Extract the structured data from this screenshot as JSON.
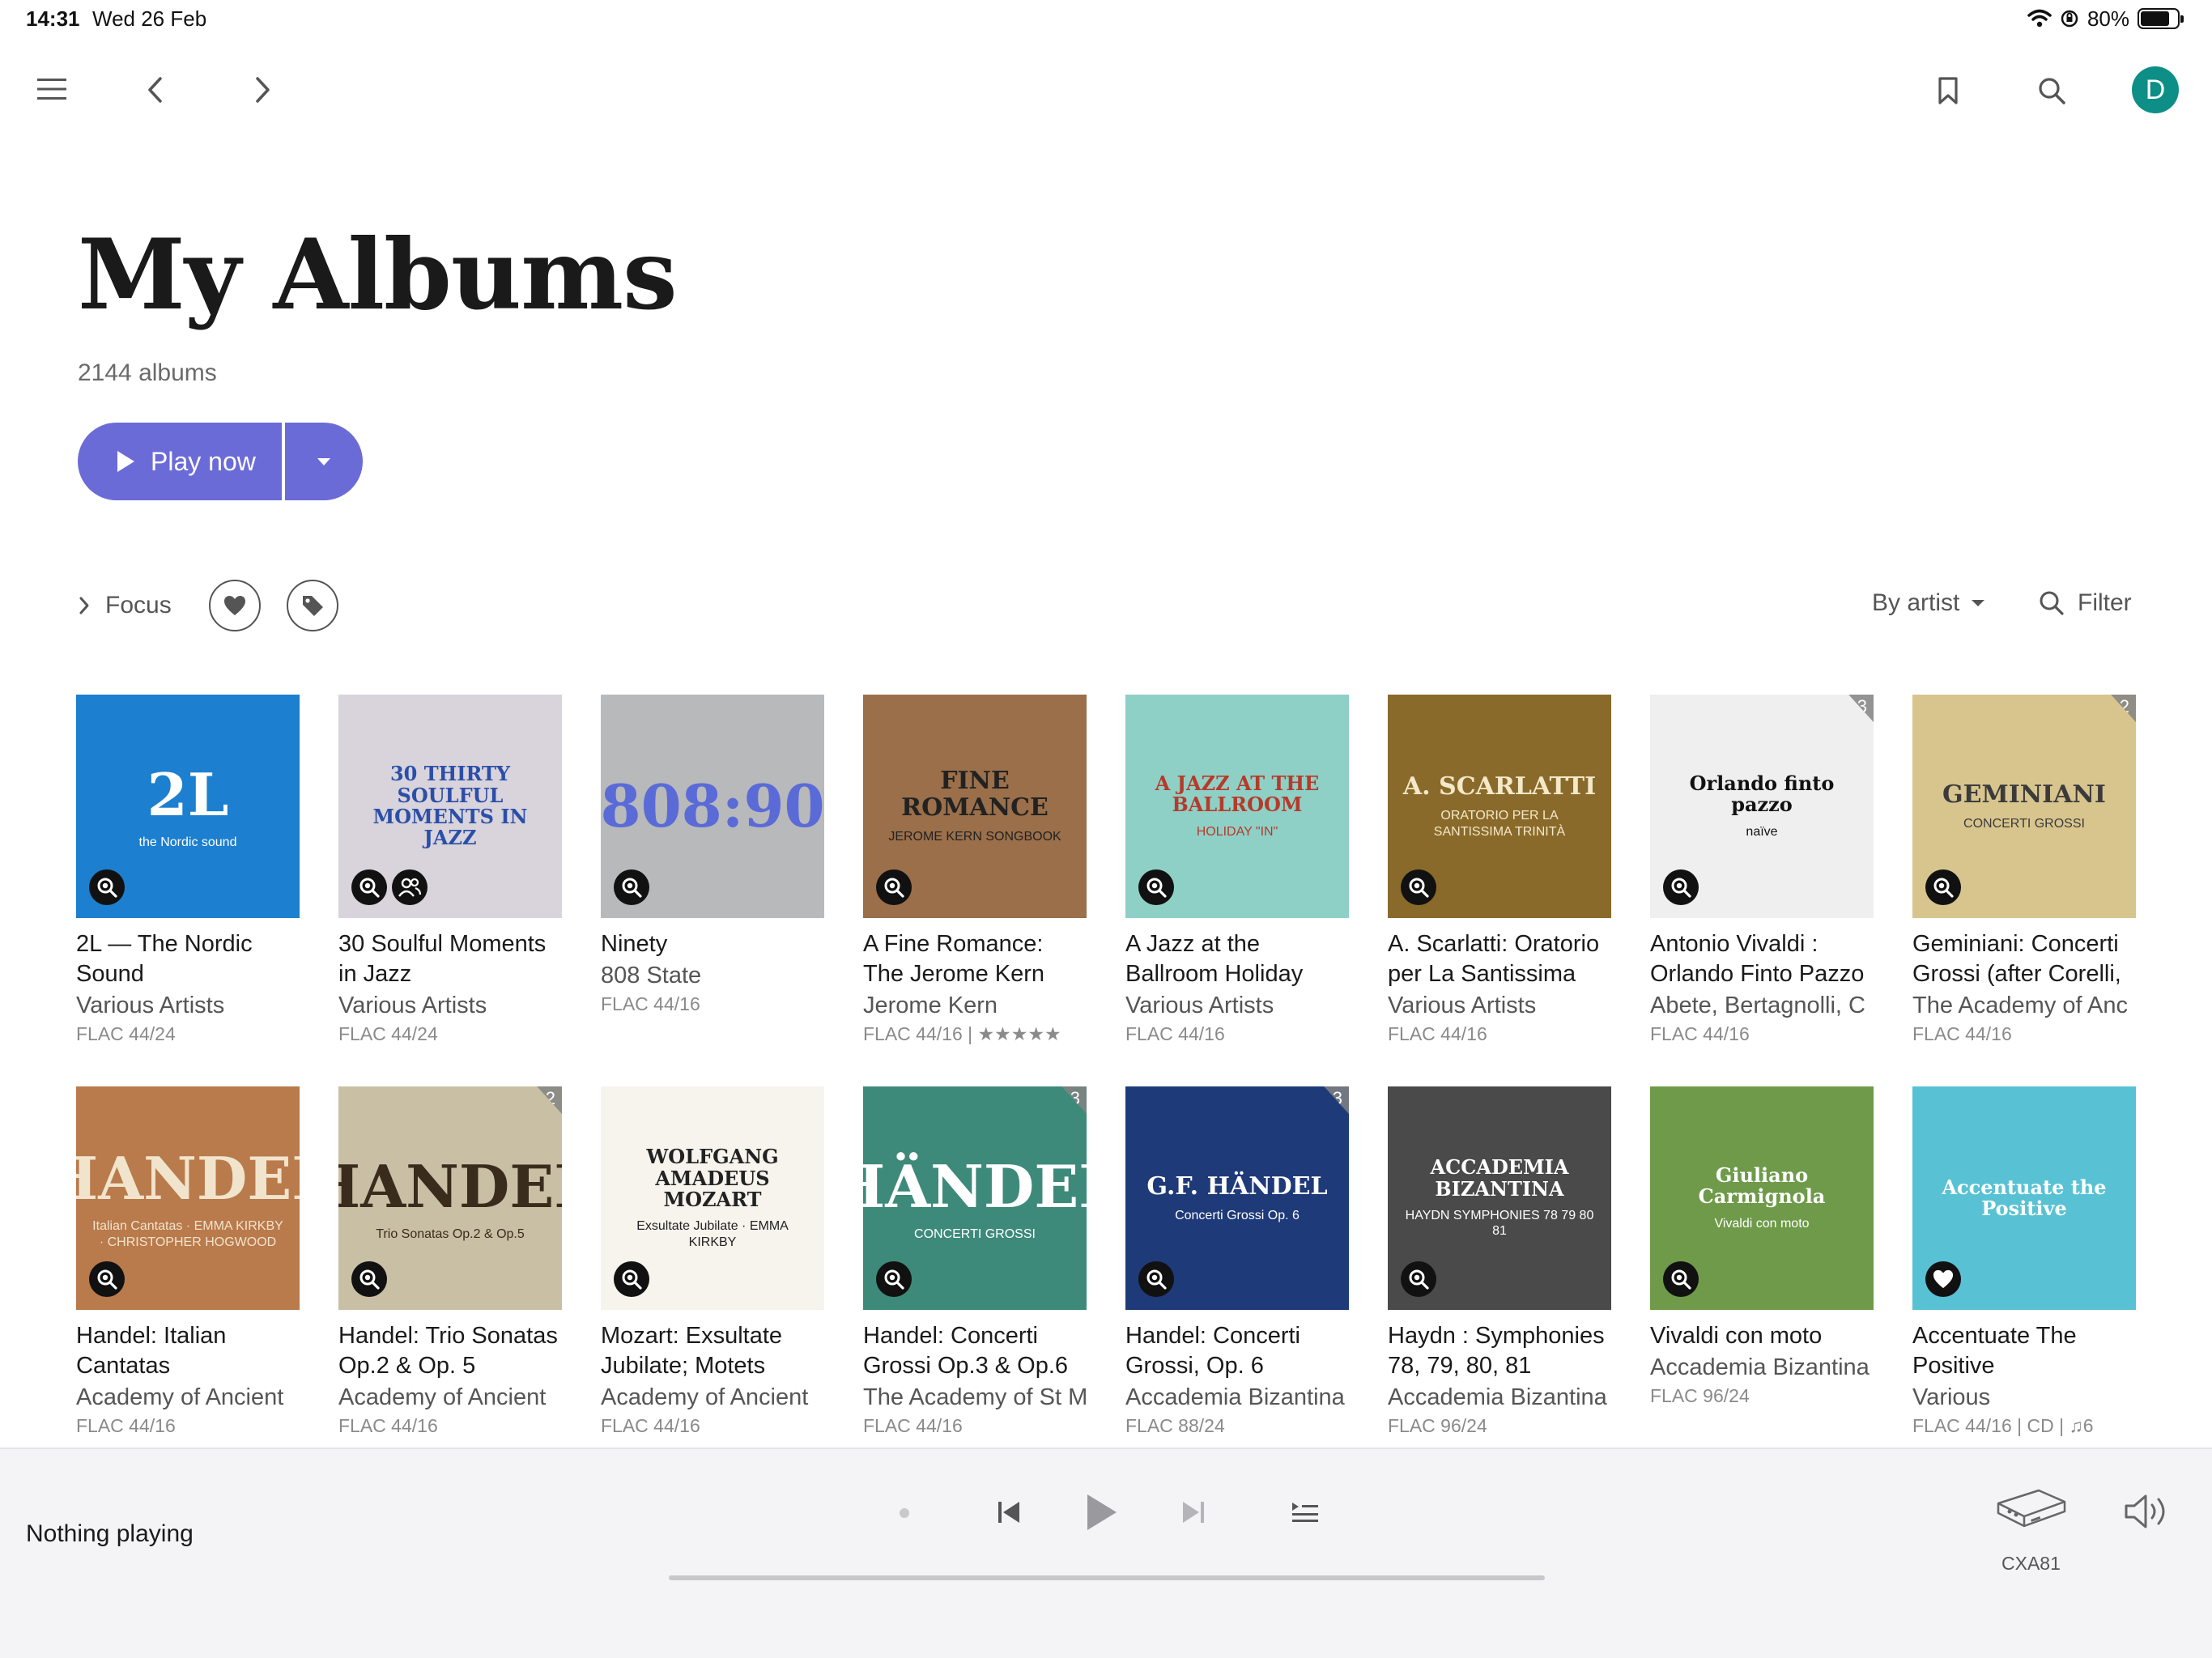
{
  "status_bar": {
    "time": "14:31",
    "date": "Wed 26 Feb",
    "battery": "80%",
    "battery_level": 0.8
  },
  "header": {
    "avatar_letter": "D"
  },
  "page": {
    "title": "My Albums",
    "count": "2144 albums",
    "play_label": "Play now"
  },
  "filters": {
    "focus_label": "Focus",
    "sort_label": "By artist",
    "filter_label": "Filter"
  },
  "albums": [
    {
      "title": "2L — The Nordic Sound",
      "artist": "Various Artists",
      "format": "FLAC 44/24"
    },
    {
      "title": "30 Soulful Moments in Jazz",
      "artist": "Various Artists",
      "format": "FLAC 44/24"
    },
    {
      "title": "Ninety",
      "artist": "808 State",
      "format": "FLAC 44/16"
    },
    {
      "title": "A Fine Romance: The Jerome Kern",
      "artist": "Jerome Kern",
      "format": "FLAC 44/16 | ★★★★★"
    },
    {
      "title": "A Jazz at the Ballroom Holiday",
      "artist": "Various Artists",
      "format": "FLAC 44/16"
    },
    {
      "title": "A. Scarlatti: Oratorio per La Santissima",
      "artist": "Various Artists",
      "format": "FLAC 44/16"
    },
    {
      "title": "Antonio Vivaldi : Orlando Finto Pazzo",
      "artist": "Abete, Bertagnolli, C",
      "format": "FLAC 44/16",
      "discs": "3"
    },
    {
      "title": "Geminiani: Concerti Grossi (after Corelli,",
      "artist": "The Academy of Anc",
      "format": "FLAC 44/16",
      "discs": "2"
    },
    {
      "title": "Handel: Italian Cantatas",
      "artist": "Academy of Ancient",
      "format": "FLAC 44/16"
    },
    {
      "title": "Handel: Trio Sonatas Op.2 & Op. 5",
      "artist": "Academy of Ancient",
      "format": "FLAC 44/16",
      "discs": "2"
    },
    {
      "title": "Mozart: Exsultate Jubilate; Motets",
      "artist": "Academy of Ancient",
      "format": "FLAC 44/16"
    },
    {
      "title": "Handel: Concerti Grossi Op.3 & Op.6",
      "artist": "The Academy of St M",
      "format": "FLAC 44/16",
      "discs": "3"
    },
    {
      "title": "Handel: Concerti Grossi, Op. 6",
      "artist": "Accademia Bizantina",
      "format": "FLAC 88/24",
      "discs": "3"
    },
    {
      "title": "Haydn : Symphonies 78, 79, 80, 81",
      "artist": "Accademia Bizantina",
      "format": "FLAC 96/24"
    },
    {
      "title": "Vivaldi con moto",
      "artist": "Accademia Bizantina",
      "format": "FLAC 96/24"
    },
    {
      "title": "Accentuate The Positive",
      "artist": "Various",
      "format": "FLAC 44/16 | CD | ♫6"
    }
  ],
  "covers": [
    {
      "text": "2L",
      "sub": "the Nordic sound",
      "bg": "#1c7fd0",
      "fg": "#ffffff"
    },
    {
      "text": "30 THIRTY SOULFUL MOMENTS IN JAZZ",
      "sub": "",
      "bg": "#d9d3db",
      "fg": "#2a4fa8"
    },
    {
      "text": "808:90",
      "sub": "",
      "bg": "#b8b9ba",
      "fg": "#5a6bd8"
    },
    {
      "text": "FINE ROMANCE",
      "sub": "JEROME KERN SONGBOOK",
      "bg": "#9a6f4a",
      "fg": "#222222"
    },
    {
      "text": "A JAZZ AT THE BALLROOM",
      "sub": "HOLIDAY \"IN\"",
      "bg": "#8fd0c6",
      "fg": "#b63a2a"
    },
    {
      "text": "A. SCARLATTI",
      "sub": "ORATORIO PER LA SANTISSIMA TRINITÀ",
      "bg": "#8a6a2a",
      "fg": "#f3e9c9"
    },
    {
      "text": "Orlando finto pazzo",
      "sub": "naïve",
      "bg": "#efefef",
      "fg": "#111111"
    },
    {
      "text": "GEMINIANI",
      "sub": "CONCERTI GROSSI",
      "bg": "#d8c58e",
      "fg": "#3b3b3b"
    },
    {
      "text": "HANDEL",
      "sub": "Italian Cantatas · EMMA KIRKBY · CHRISTOPHER HOGWOOD",
      "bg": "#b97a4c",
      "fg": "#f1e4cc"
    },
    {
      "text": "HANDEL",
      "sub": "Trio Sonatas Op.2 & Op.5",
      "bg": "#c9bfa4",
      "fg": "#3a2c1c"
    },
    {
      "text": "WOLFGANG AMADEUS MOZART",
      "sub": "Exsultate Jubilate · EMMA KIRKBY",
      "bg": "#f7f4ee",
      "fg": "#222222"
    },
    {
      "text": "HÄNDEL",
      "sub": "CONCERTI GROSSI",
      "bg": "#3d8a7a",
      "fg": "#ffffff"
    },
    {
      "text": "G.F. HÄNDEL",
      "sub": "Concerti Grossi Op. 6",
      "bg": "#1f3a78",
      "fg": "#ffffff"
    },
    {
      "text": "ACCADEMIA BIZANTINA",
      "sub": "HAYDN SYMPHONIES 78 79 80 81",
      "bg": "#4a4a4a",
      "fg": "#ffffff"
    },
    {
      "text": "Giuliano Carmignola",
      "sub": "Vivaldi con moto",
      "bg": "#6e9a4a",
      "fg": "#ffffff"
    },
    {
      "text": "Accentuate the Positive",
      "sub": "",
      "bg": "#58c2d4",
      "fg": "#ffffff"
    }
  ],
  "player": {
    "status": "Nothing playing",
    "device": "CXA81"
  },
  "colors": {
    "accent": "#6b6bd8",
    "avatar": "#0d8e86",
    "player_bg": "#f4f4f6"
  }
}
